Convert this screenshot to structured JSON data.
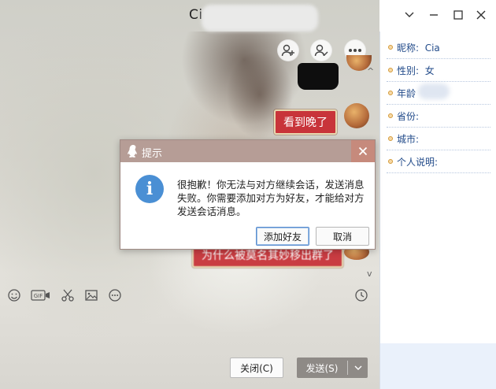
{
  "window": {
    "title_visible": "Ci",
    "min_icon": "chevron-down",
    "minimize_icon": "minus",
    "maximize_icon": "square",
    "close_icon": "x"
  },
  "actions": {
    "add_friend_icon": "person-plus",
    "profile_icon": "person-check",
    "more_icon": "ellipsis"
  },
  "messages": [
    {
      "type": "sticker",
      "side": "right"
    },
    {
      "type": "text",
      "side": "right",
      "text": "看到晚了"
    },
    {
      "type": "text",
      "side": "right",
      "text": "为什么被莫名其妙移出群了",
      "partially_hidden": true
    }
  ],
  "toolbar": {
    "items": [
      "emoji-icon",
      "gif-icon",
      "scissors-icon",
      "image-icon",
      "more-icon"
    ],
    "gif_label": "GIF",
    "history_icon": "clock-icon"
  },
  "buttons": {
    "close_label": "关闭(C)",
    "send_label": "发送(S)"
  },
  "profile": {
    "nickname_label": "昵称:",
    "nickname_value": "Cia",
    "gender_label": "性别:",
    "gender_value": "女",
    "age_label": "年龄",
    "province_label": "省份:",
    "city_label": "城市:",
    "bio_label": "个人说明:"
  },
  "dialog": {
    "title": "提示",
    "message": "很抱歉！你无法与对方继续会话，发送消息失败。你需要添加对方为好友，才能给对方发送会话消息。",
    "add_friend_label": "添加好友",
    "cancel_label": "取消",
    "info_glyph": "i"
  },
  "colors": {
    "bubble": "#c8343a",
    "dialog_header": "#b69d96",
    "info_blue": "#4a8fd4",
    "send_button": "#8e8a86"
  }
}
